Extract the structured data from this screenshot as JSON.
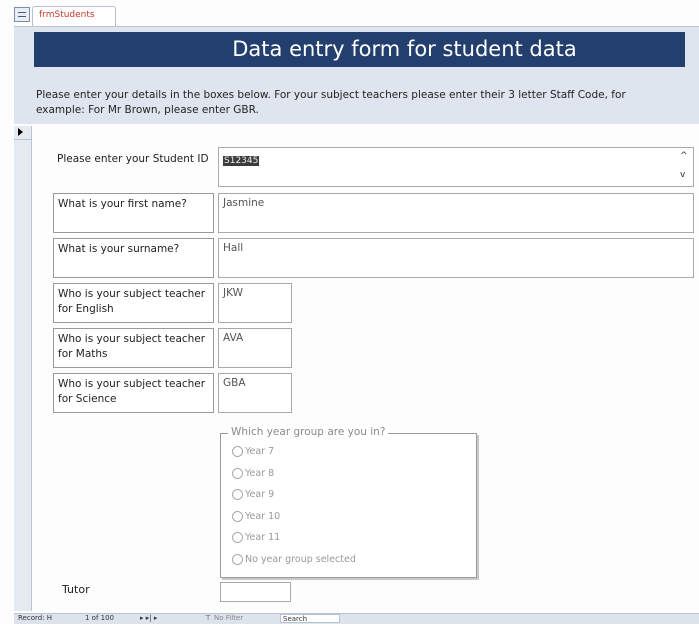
{
  "tab": {
    "label": "frmStudents"
  },
  "header": {
    "title": "Data entry form for student data",
    "intro": "Please enter your details in the boxes below. For your subject teachers please enter their 3 letter Staff Code, for example: For Mr Brown, please enter GBR."
  },
  "fields": {
    "student_id": {
      "label": "Please enter your Student ID",
      "value": "S12345"
    },
    "first_name": {
      "label": "What is your first name?",
      "value": "Jasmine"
    },
    "surname": {
      "label": "What is your surname?",
      "value": "Hall"
    },
    "english": {
      "label": "Who is your subject teacher for English",
      "value": "JKW"
    },
    "maths": {
      "label": "Who is your subject teacher for Maths",
      "value": "AVA"
    },
    "science": {
      "label": "Who is your subject teacher for Science",
      "value": "GBA"
    }
  },
  "year_group": {
    "legend": "Which year group are you in?",
    "options": [
      "Year 7",
      "Year 8",
      "Year 9",
      "Year 10",
      "Year 11",
      "No year group selected"
    ]
  },
  "tutor": {
    "label": "Tutor",
    "value": ""
  },
  "navigation": {
    "record_label": "Record: H",
    "record_position": "1 of 100",
    "nav_buttons": "▸ ▸| ▸",
    "filter": "No Filter",
    "search": "Search"
  },
  "icons": [
    "form-icon",
    "record-selector-arrow-icon",
    "scroll-up-icon",
    "scroll-down-icon",
    "radio-icon",
    "filter-icon"
  ],
  "colors": {
    "title_bar": "#223f6e",
    "header_bg": "#dfe5ee",
    "tab_text": "#c03a2b"
  }
}
